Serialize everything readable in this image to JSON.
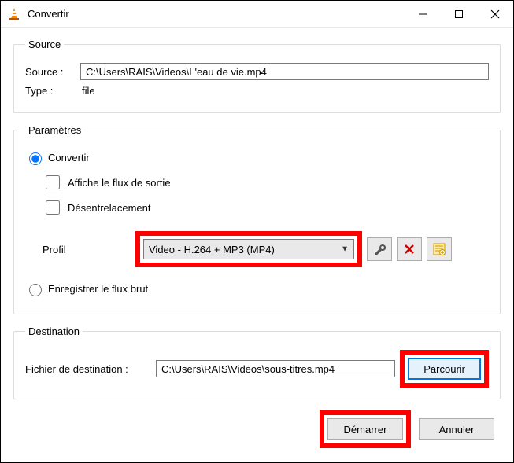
{
  "window": {
    "title": "Convertir"
  },
  "source": {
    "legend": "Source",
    "source_label": "Source :",
    "source_value": "C:\\Users\\RAIS\\Videos\\L'eau de vie.mp4",
    "type_label": "Type :",
    "type_value": "file"
  },
  "params": {
    "legend": "Paramètres",
    "convert_label": "Convertir",
    "show_output_label": "Affiche le flux de sortie",
    "deinterlace_label": "Désentrelacement",
    "profile_label": "Profil",
    "profile_value": "Video - H.264 + MP3 (MP4)",
    "raw_dump_label": "Enregistrer le flux brut"
  },
  "destination": {
    "legend": "Destination",
    "file_label": "Fichier de destination :",
    "file_value": "C:\\Users\\RAIS\\Videos\\sous-titres.mp4",
    "browse_label": "Parcourir"
  },
  "footer": {
    "start_label": "Démarrer",
    "cancel_label": "Annuler"
  }
}
